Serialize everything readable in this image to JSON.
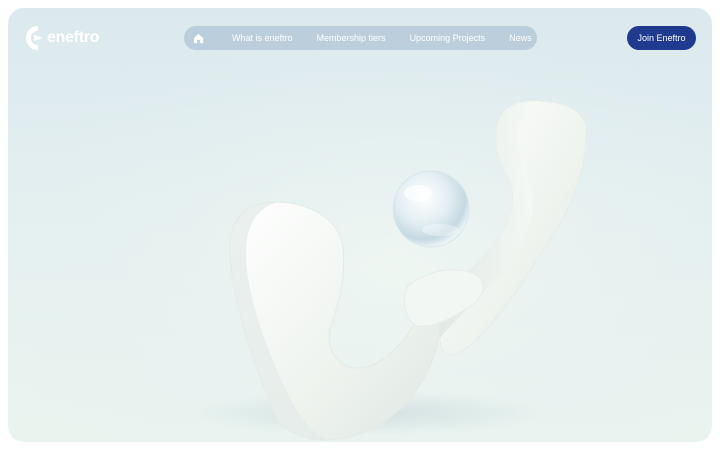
{
  "brand": {
    "name": "eneftro",
    "logo_icon": "eneftro-logo-icon"
  },
  "nav": {
    "home_icon": "home-icon",
    "items": [
      {
        "label": "What is eneftro"
      },
      {
        "label": "Membership tiers"
      },
      {
        "label": "Upcoming Projects"
      },
      {
        "label": "News"
      }
    ]
  },
  "cta": {
    "label": "Join Eneftro"
  },
  "colors": {
    "background": "#ffffff",
    "hero_top": "#dbe9ee",
    "hero_bottom": "#eaf4ef",
    "nav_pill": "#afc4d6",
    "button": "#1f3a8f",
    "text_on_dark": "#ffffff"
  }
}
